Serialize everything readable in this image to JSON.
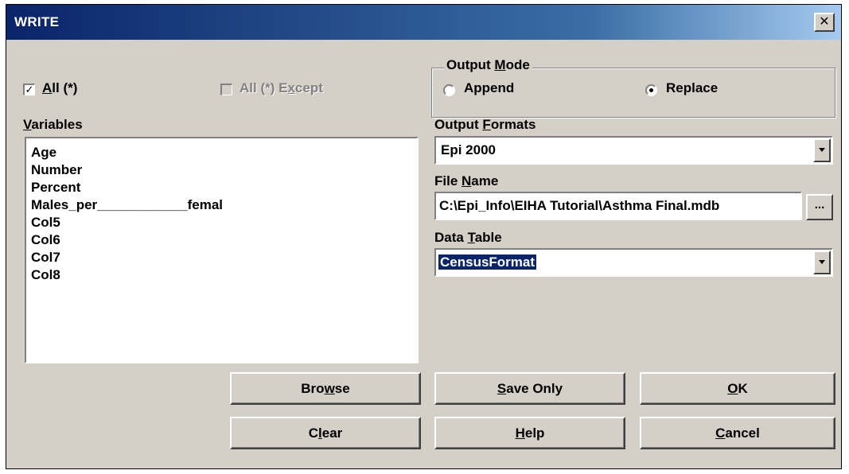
{
  "window": {
    "title": "WRITE",
    "close_label": "✕"
  },
  "select": {
    "all_label_prefix": "",
    "all_mnemonic": "A",
    "all_rest": "ll (*)",
    "all_checked": true,
    "all_except_label_pre": "All (*) E",
    "all_except_mnemonic": "x",
    "all_except_label_post": "cept",
    "all_except_enabled": false
  },
  "variables": {
    "label_mnemonic": "V",
    "label_rest": "ariables",
    "items": [
      "Age",
      "Number",
      "Percent",
      "Males_per____________femal",
      "Col5",
      "Col6",
      "Col7",
      "Col8"
    ]
  },
  "output_mode": {
    "legend_pre": "Output ",
    "legend_mnemonic": "M",
    "legend_post": "ode",
    "append_label": "Append",
    "replace_label": "Replace",
    "selected": "Replace"
  },
  "output_formats": {
    "label_pre": "Output ",
    "label_mnemonic": "F",
    "label_post": "ormats",
    "value": "Epi 2000"
  },
  "file_name": {
    "label_pre": "File ",
    "label_mnemonic": "N",
    "label_post": "ame",
    "value": "C:\\Epi_Info\\EIHA Tutorial\\Asthma Final.mdb",
    "browse_label": "..."
  },
  "data_table": {
    "label_pre": "Data ",
    "label_mnemonic": "T",
    "label_post": "able",
    "value": "CensusFormat"
  },
  "buttons": {
    "browse": {
      "pre": "Bro",
      "mn": "w",
      "post": "se"
    },
    "save_only": {
      "pre": "",
      "mn": "S",
      "post": "ave Only"
    },
    "ok": {
      "pre": "",
      "mn": "O",
      "post": "K"
    },
    "clear": {
      "pre": "C",
      "mn": "l",
      "post": "ear"
    },
    "help": {
      "pre": "",
      "mn": "H",
      "post": "elp"
    },
    "cancel": {
      "pre": "",
      "mn": "C",
      "post": "ancel"
    }
  },
  "colors": {
    "title_bar": "#0a246a",
    "face": "#d4d0c8",
    "selection": "#0a246a"
  }
}
